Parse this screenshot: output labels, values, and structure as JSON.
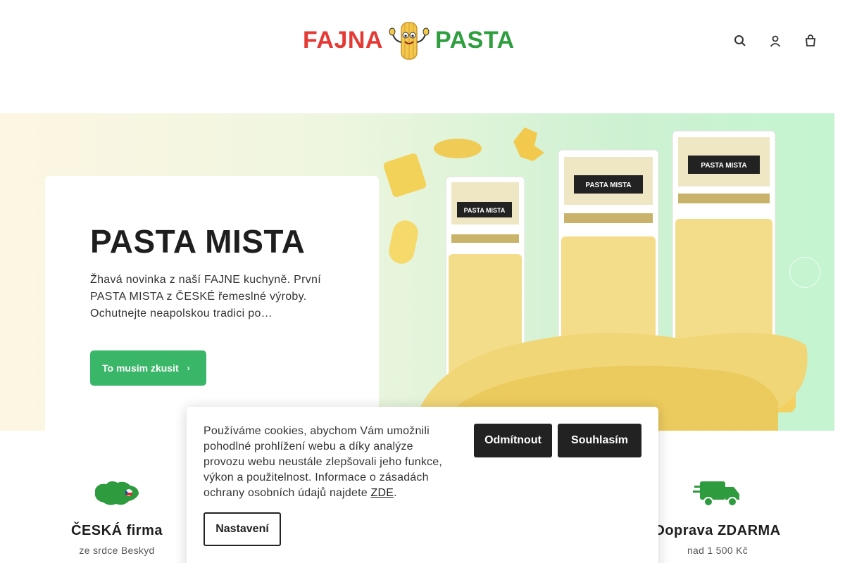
{
  "header": {
    "logo": {
      "left_word": "FAJNA",
      "right_word": "PASTA"
    },
    "icons": [
      "search-icon",
      "user-icon",
      "cart-icon"
    ]
  },
  "hero": {
    "title": "PASTA MISTA",
    "text": "Žhavá novinka z naší FAJNE kuchyně. První PASTA MISTA z ČESKÉ řemeslné výroby. Ochutnejte neapolskou tradici po…",
    "button_label": "To musím zkusit",
    "button_arrow": "›",
    "package_label": "PASTA MISTA"
  },
  "features": [
    {
      "icon": "czech-map-icon",
      "title": "ČESKÁ firma",
      "subtitle": "ze srdce Beskyd"
    },
    {
      "icon": "truck-icon",
      "title": "Doprava ZDARMA",
      "subtitle": "nad 1 500 Kč"
    }
  ],
  "cookie": {
    "text_before_link": "Používáme cookies, abychom Vám umožnili pohodlné prohlížení webu a díky analýze provozu webu neustále zlepšovali jeho funkce, výkon a použitelnost. Informace o zásadách ochrany osobních údajů najdete ",
    "link_label": "ZDE",
    "text_after_link": ".",
    "reject_label": "Odmítnout",
    "accept_label": "Souhlasím",
    "settings_label": "Nastavení"
  },
  "colors": {
    "brand_red": "#e53935",
    "brand_green": "#2e9e3e",
    "button_green": "#3ab669",
    "dark_button": "#222222"
  }
}
